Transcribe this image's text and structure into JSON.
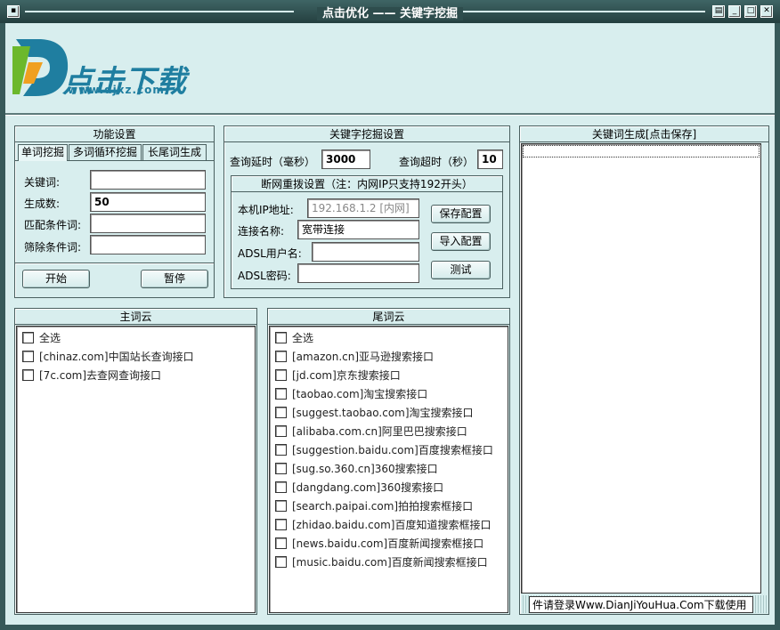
{
  "window": {
    "title": "点击优化 —— 关键字挖掘"
  },
  "logo": {
    "brand": "点击下载",
    "url": "www.djxz.com"
  },
  "function_panel": {
    "title": "功能设置",
    "tabs": [
      "单词挖掘",
      "多词循环挖掘",
      "长尾词生成"
    ],
    "keyword_label": "关键词:",
    "keyword_value": "",
    "count_label": "生成数:",
    "count_value": "50",
    "match_label": "匹配条件词:",
    "match_value": "",
    "filter_label": "筛除条件词:",
    "filter_value": "",
    "start_label": "开始",
    "pause_label": "暂停"
  },
  "mining_panel": {
    "title": "关键字挖掘设置",
    "delay_label": "查询延时（毫秒）",
    "delay_value": "3000",
    "timeout_label": "查询超时（秒）",
    "timeout_value": "10",
    "redial": {
      "title": "断网重拨设置（注：内网IP只支持192开头）",
      "ip_label": "本机IP地址:",
      "ip_placeholder": "192.168.1.2 [内网]",
      "conn_label": "连接名称:",
      "conn_value": "宽带连接",
      "adsl_user_label": "ADSL用户名:",
      "adsl_user_value": "",
      "adsl_pwd_label": "ADSL密码:",
      "adsl_pwd_value": "",
      "save_label": "保存配置",
      "import_label": "导入配置",
      "test_label": "测试"
    }
  },
  "result_panel": {
    "title": "关键词生成[点击保存]",
    "status": "件请登录Www.DianJiYouHua.Com下载使用"
  },
  "main_cloud": {
    "title": "主词云",
    "items": [
      "全选",
      "[chinaz.com]中国站长查询接口",
      "[7c.com]去查网查询接口"
    ]
  },
  "tail_cloud": {
    "title": "尾词云",
    "items": [
      "全选",
      "[amazon.cn]亚马逊搜索接口",
      "[jd.com]京东搜索接口",
      "[taobao.com]淘宝搜索接口",
      "[suggest.taobao.com]淘宝搜索接口",
      "[alibaba.com.cn]阿里巴巴搜索接口",
      "[suggestion.baidu.com]百度搜索框接口",
      "[sug.so.360.cn]360搜索接口",
      "[dangdang.com]360搜索接口",
      "[search.paipai.com]拍拍搜索框接口",
      "[zhidao.baidu.com]百度知道搜索框接口",
      "[news.baidu.com]百度新闻搜索框接口",
      "[music.baidu.com]百度新闻搜索框接口"
    ]
  }
}
